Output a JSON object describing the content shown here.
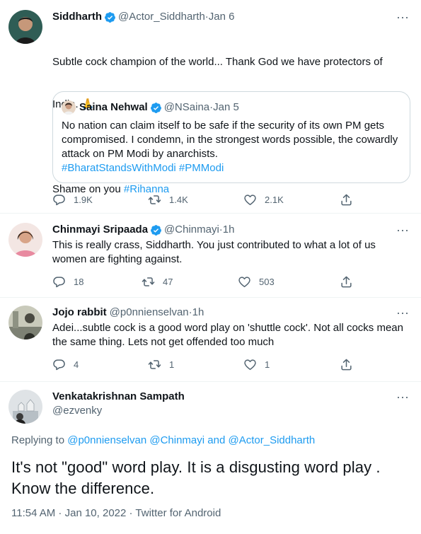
{
  "tweets": [
    {
      "name": "Siddharth",
      "verified": true,
      "handle": "@Actor_Siddharth",
      "time": "Jan 6",
      "text_line1": "Subtle cock champion of the world... Thank God we have protectors of",
      "text_line2": "India. 🙏",
      "text_shame": "Shame on you ",
      "hashtag": "#Rihanna",
      "quote": {
        "name": "Saina Nehwal",
        "verified": true,
        "handle": "@NSaina",
        "time": "Jan 5",
        "text": "No nation can claim itself to be safe if the security of its own PM gets compromised. I condemn, in the strongest words possible, the cowardly attack on PM Modi by anarchists.",
        "hashtags": "#BharatStandsWithModi #PMModi"
      },
      "replies": "1.9K",
      "retweets": "1.4K",
      "likes": "2.1K"
    },
    {
      "name": "Chinmayi Sripaada",
      "verified": true,
      "handle": "@Chinmayi",
      "time": "1h",
      "text": "This is really crass, Siddharth. You just contributed to what a lot of us women are fighting against.",
      "replies": "18",
      "retweets": "47",
      "likes": "503"
    },
    {
      "name": "Jojo rabbit",
      "verified": false,
      "handle": "@p0nnienselvan",
      "time": "1h",
      "text": "Adei...subtle cock is a good word play on 'shuttle cock'. Not all cocks mean the same thing. Lets not get offended too much",
      "replies": "4",
      "retweets": "1",
      "likes": "1"
    }
  ],
  "main": {
    "name": "Venkatakrishnan Sampath",
    "handle": "@ezvenky",
    "replying_prefix": "Replying to ",
    "replying_to": "@p0nnienselvan @Chinmayi",
    "replying_and": " and ",
    "replying_last": "@Actor_Siddharth",
    "text": "It's not \"good\" word play. It is a disgusting word play . Know the difference.",
    "time": "11:54 AM",
    "date": "Jan 10, 2022",
    "source": "Twitter for Android"
  },
  "symbols": {
    "dot": "·",
    "more": "···",
    "sep": " · "
  },
  "colors": {
    "accent": "#1d9bf0",
    "secondary": "#536471",
    "border": "#cfd9de"
  },
  "icons": [
    "verified-badge-icon",
    "reply-icon",
    "retweet-icon",
    "like-icon",
    "share-icon",
    "more-icon"
  ]
}
